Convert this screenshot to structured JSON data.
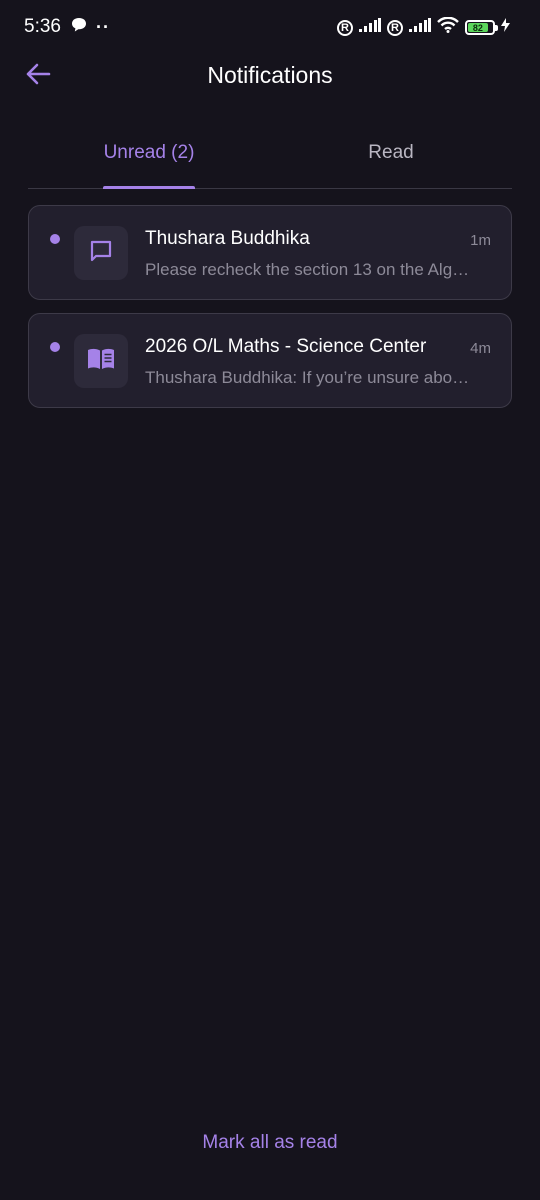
{
  "status_bar": {
    "time": "5:36",
    "dots": "··",
    "battery_level": "82",
    "registered_mark": "R"
  },
  "header": {
    "title": "Notifications"
  },
  "tabs": [
    {
      "label": "Unread (2)",
      "active": true
    },
    {
      "label": "Read",
      "active": false
    }
  ],
  "notifications": [
    {
      "title": "Thushara Buddhika",
      "time": "1m",
      "body": "Please recheck the section 13 on the Alg…",
      "icon": "chat-icon",
      "unread": true
    },
    {
      "title": "2026 O/L Maths - Science Center",
      "time": "4m",
      "body": "Thushara Buddhika: If you’re unsure abo…",
      "icon": "book-icon",
      "unread": true
    }
  ],
  "footer": {
    "mark_all_label": "Mark all as read"
  },
  "colors": {
    "background": "#15131c",
    "accent": "#a582e8",
    "card": "#221f2d",
    "muted_text": "#8d8a98"
  }
}
